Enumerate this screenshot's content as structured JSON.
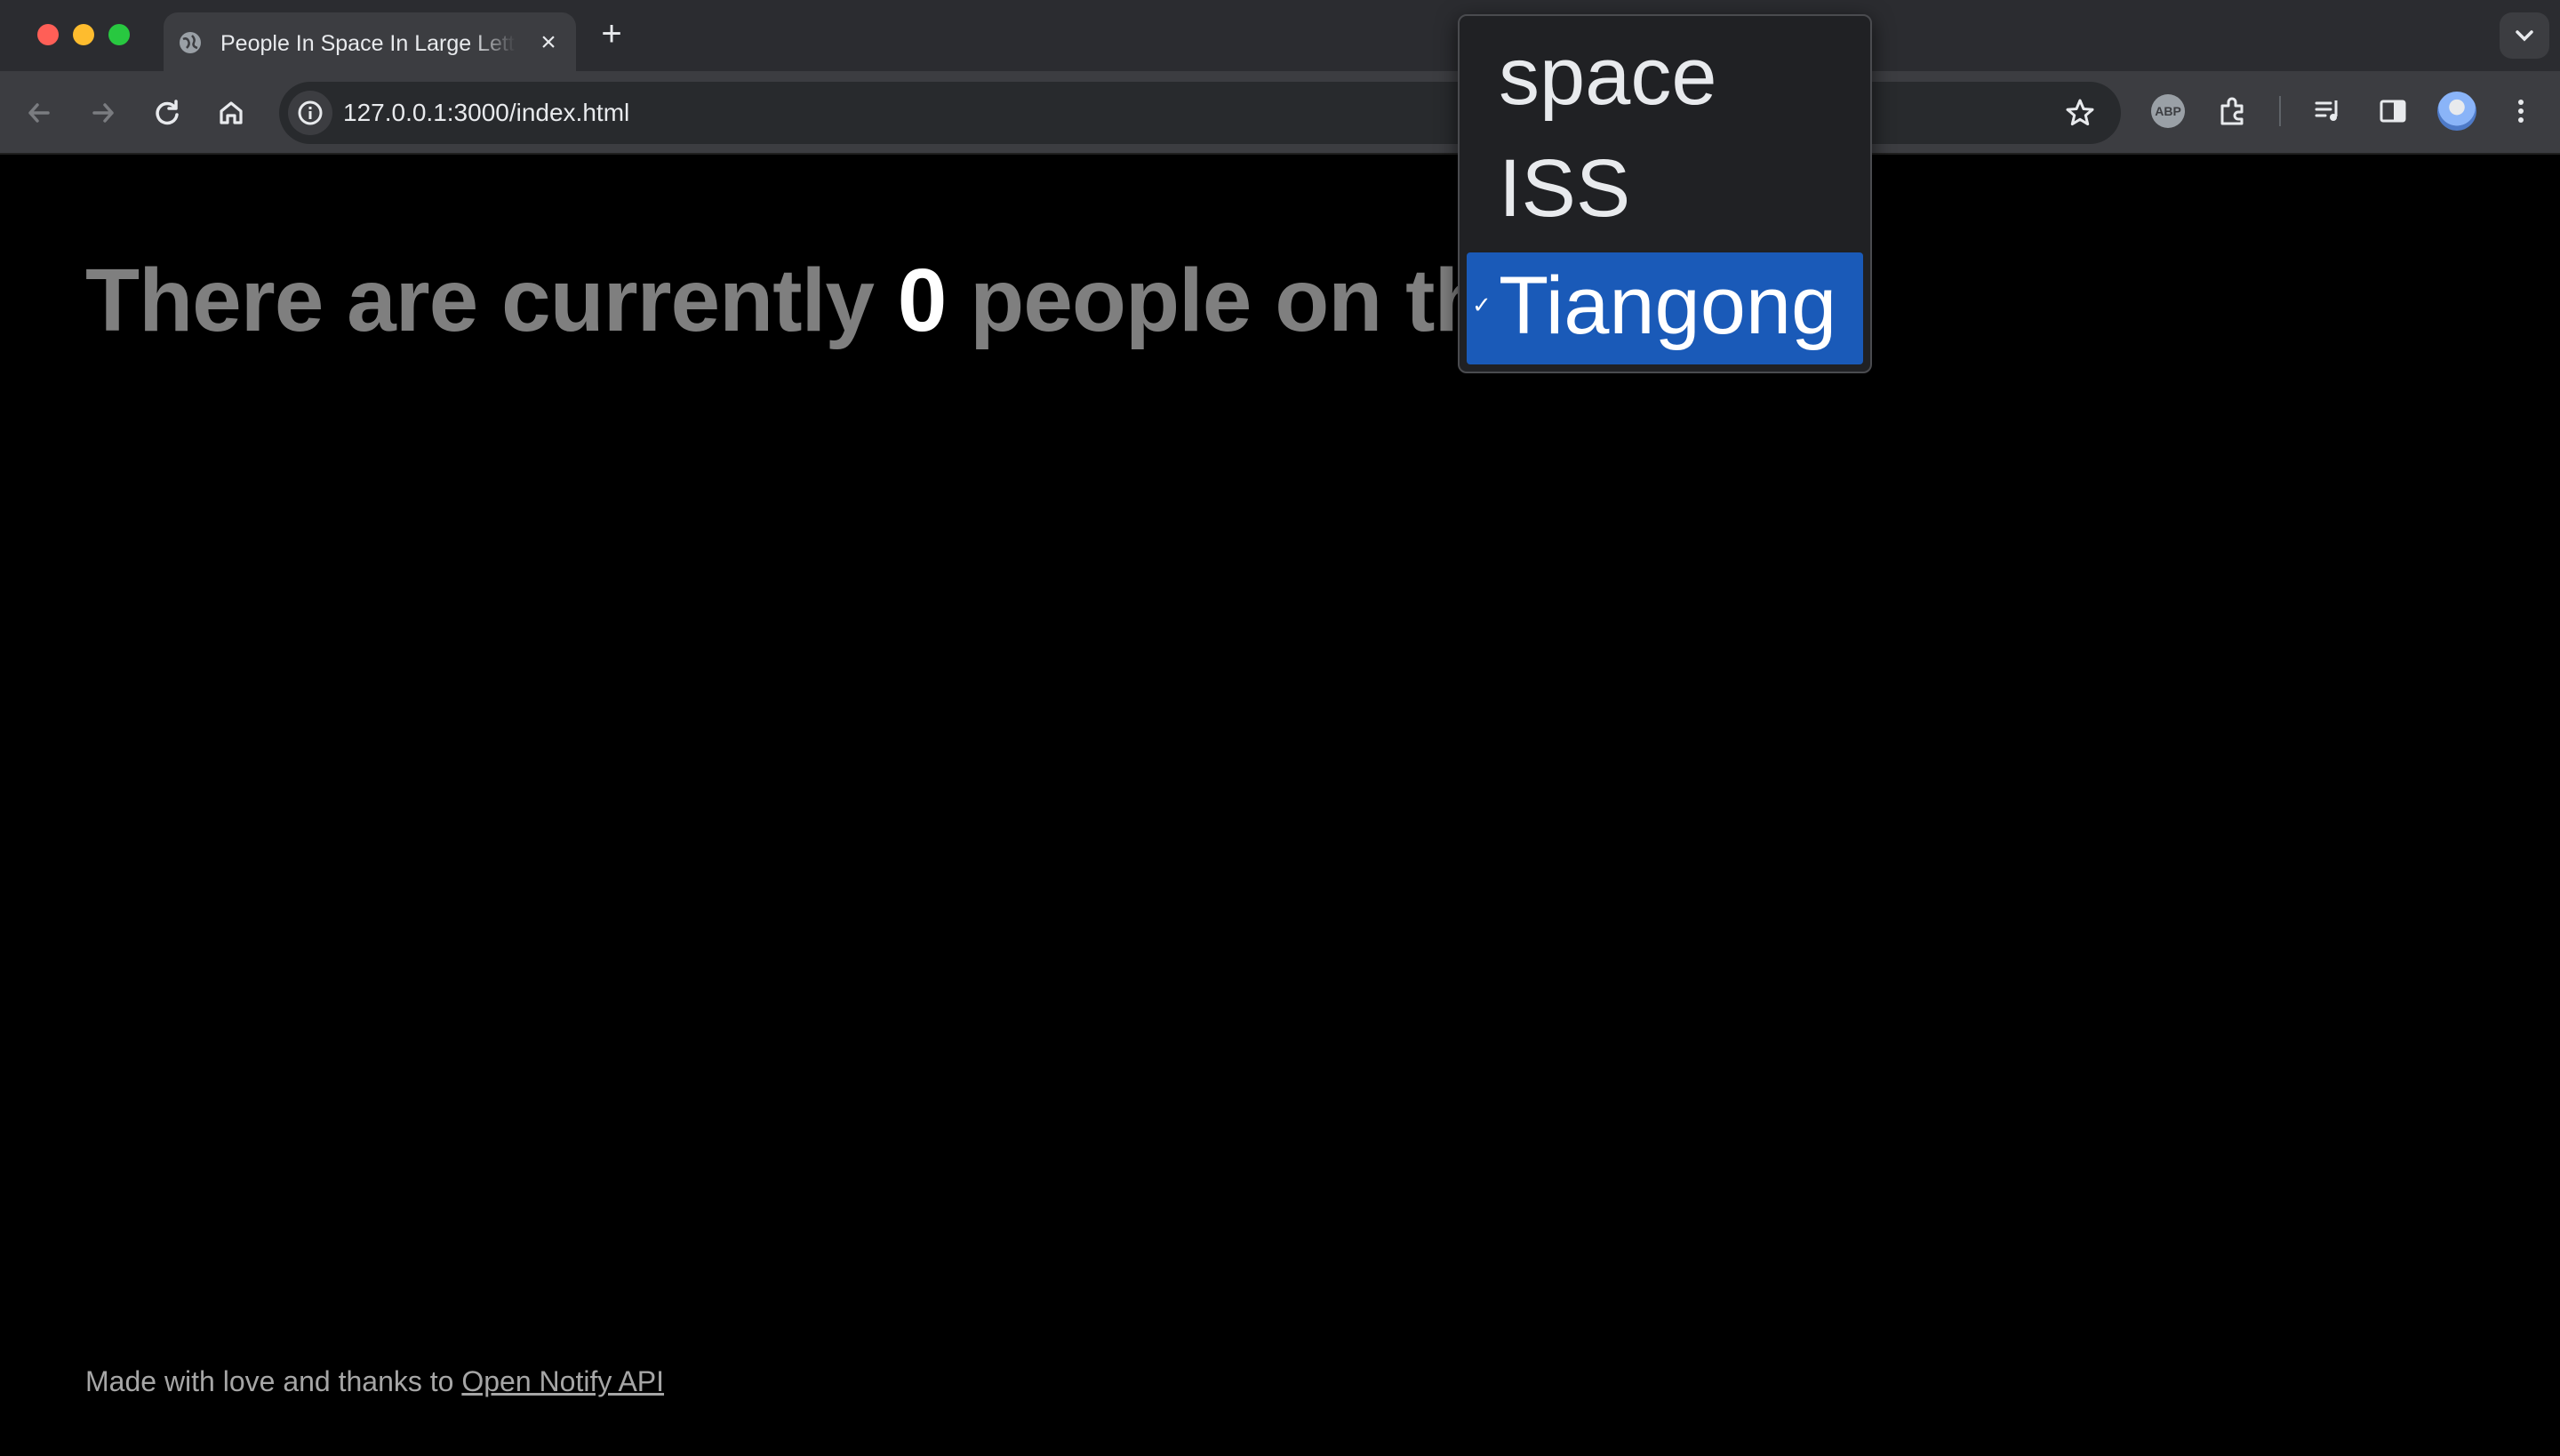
{
  "browser": {
    "tab": {
      "title": "People In Space In Large Letters",
      "close_icon": "×"
    },
    "new_tab_icon": "+",
    "address_bar": {
      "url": "127.0.0.1:3000/index.html"
    },
    "extensions": {
      "abp_label": "ABP"
    }
  },
  "page": {
    "headline": {
      "prefix": "There are currently ",
      "count": "0",
      "suffix": " people on the"
    },
    "select": {
      "options": [
        "space",
        "ISS",
        "Tiangong"
      ],
      "selected": "Tiangong",
      "check_mark": "✓"
    },
    "footer": {
      "text": "Made with love and thanks to ",
      "link": "Open Notify API"
    }
  },
  "colors": {
    "background": "#000000",
    "headline_text": "#7f7f7f",
    "count_text": "#ffffff",
    "selected_option": "#1a5ab8"
  }
}
